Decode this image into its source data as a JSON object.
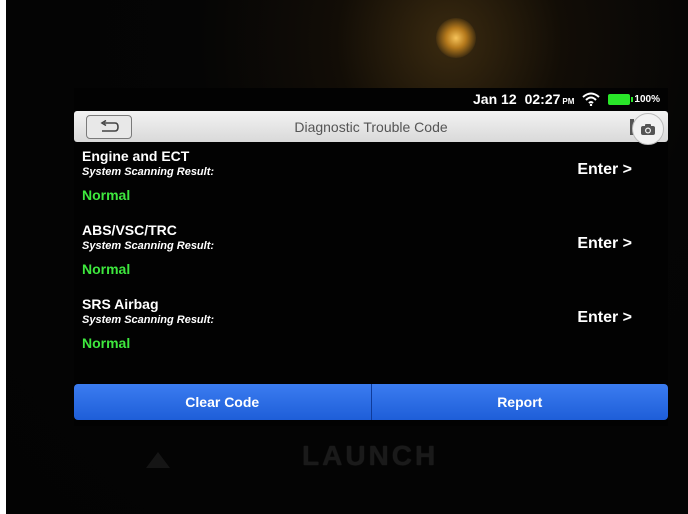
{
  "status": {
    "date": "Jan 12",
    "time": "02:27",
    "ampm": "PM",
    "battery": "100%"
  },
  "header": {
    "title": "Diagnostic Trouble Code"
  },
  "items": [
    {
      "name": "Engine and ECT",
      "subtitle": "System Scanning Result:",
      "status": "Normal",
      "action": "Enter >"
    },
    {
      "name": "ABS/VSC/TRC",
      "subtitle": "System Scanning Result:",
      "status": "Normal",
      "action": "Enter >"
    },
    {
      "name": "SRS Airbag",
      "subtitle": "System Scanning Result:",
      "status": "Normal",
      "action": "Enter >"
    }
  ],
  "footer": {
    "clear_label": "Clear Code",
    "report_label": "Report"
  },
  "device": {
    "logo": "LAUNCH"
  },
  "colors": {
    "status_normal": "#3ee83e",
    "action_bar": "#2a6de6",
    "battery": "#29e629"
  }
}
